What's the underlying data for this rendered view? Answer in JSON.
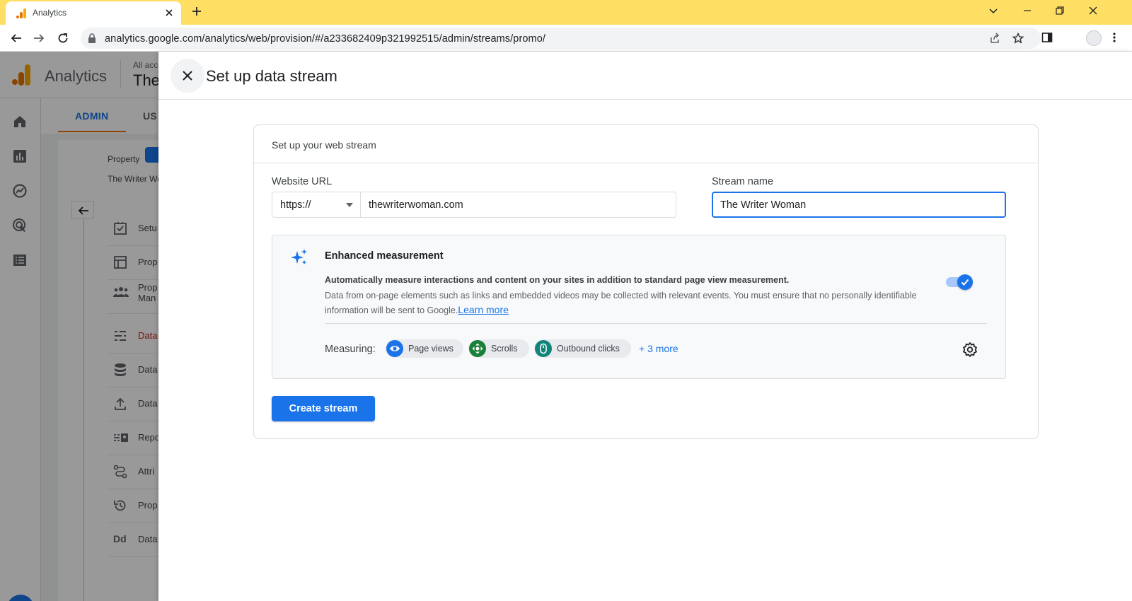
{
  "browser": {
    "tab_title": "Analytics",
    "url": "analytics.google.com/analytics/web/provision/#/a233682409p321992515/admin/streams/promo/",
    "accent_color": "#fedf63"
  },
  "ga": {
    "app_title": "Analytics",
    "account_label": "All acc",
    "property_title": "The",
    "tabs": [
      "ADMIN",
      "US"
    ],
    "property_label": "Property",
    "property_name": "The Writer Wo",
    "menu": [
      {
        "label": "Setu",
        "icon": "checkbox-icon"
      },
      {
        "label": "Prop",
        "icon": "layout-icon"
      },
      {
        "label": "Prop\nMan",
        "icon": "people-icon"
      },
      {
        "label": "Data",
        "icon": "data-streams-icon"
      },
      {
        "label": "Data",
        "icon": "database-icon"
      },
      {
        "label": "Data",
        "icon": "upload-icon"
      },
      {
        "label": "Repo",
        "icon": "reporting-identity-icon"
      },
      {
        "label": "Attri",
        "icon": "attribution-icon"
      },
      {
        "label": "Prop",
        "icon": "history-icon"
      },
      {
        "label": "Data",
        "icon": "dd-icon"
      }
    ]
  },
  "sheet": {
    "title": "Set up data stream",
    "card_title": "Set up your web stream",
    "website_url_label": "Website URL",
    "protocol": "https://",
    "website_url": "thewriterwoman.com",
    "stream_name_label": "Stream name",
    "stream_name": "The Writer Woman",
    "enhanced": {
      "title": "Enhanced measurement",
      "bold_text": "Automatically measure interactions and content on your sites in addition to standard page view measurement.",
      "description": "Data from on-page elements such as links and embedded videos may be collected with relevant events. You must ensure that no personally identifiable information will be sent to Google.",
      "learn_more": "Learn more",
      "enabled": true,
      "measuring_label": "Measuring:",
      "chips": [
        {
          "label": "Page views",
          "icon": "eye-icon",
          "color": "#1a73e8"
        },
        {
          "label": "Scrolls",
          "icon": "scroll-arrows-icon",
          "color": "#188038"
        },
        {
          "label": "Outbound clicks",
          "icon": "mouse-icon",
          "color": "#12857a"
        }
      ],
      "more": "+ 3 more"
    },
    "create_button": "Create stream"
  }
}
